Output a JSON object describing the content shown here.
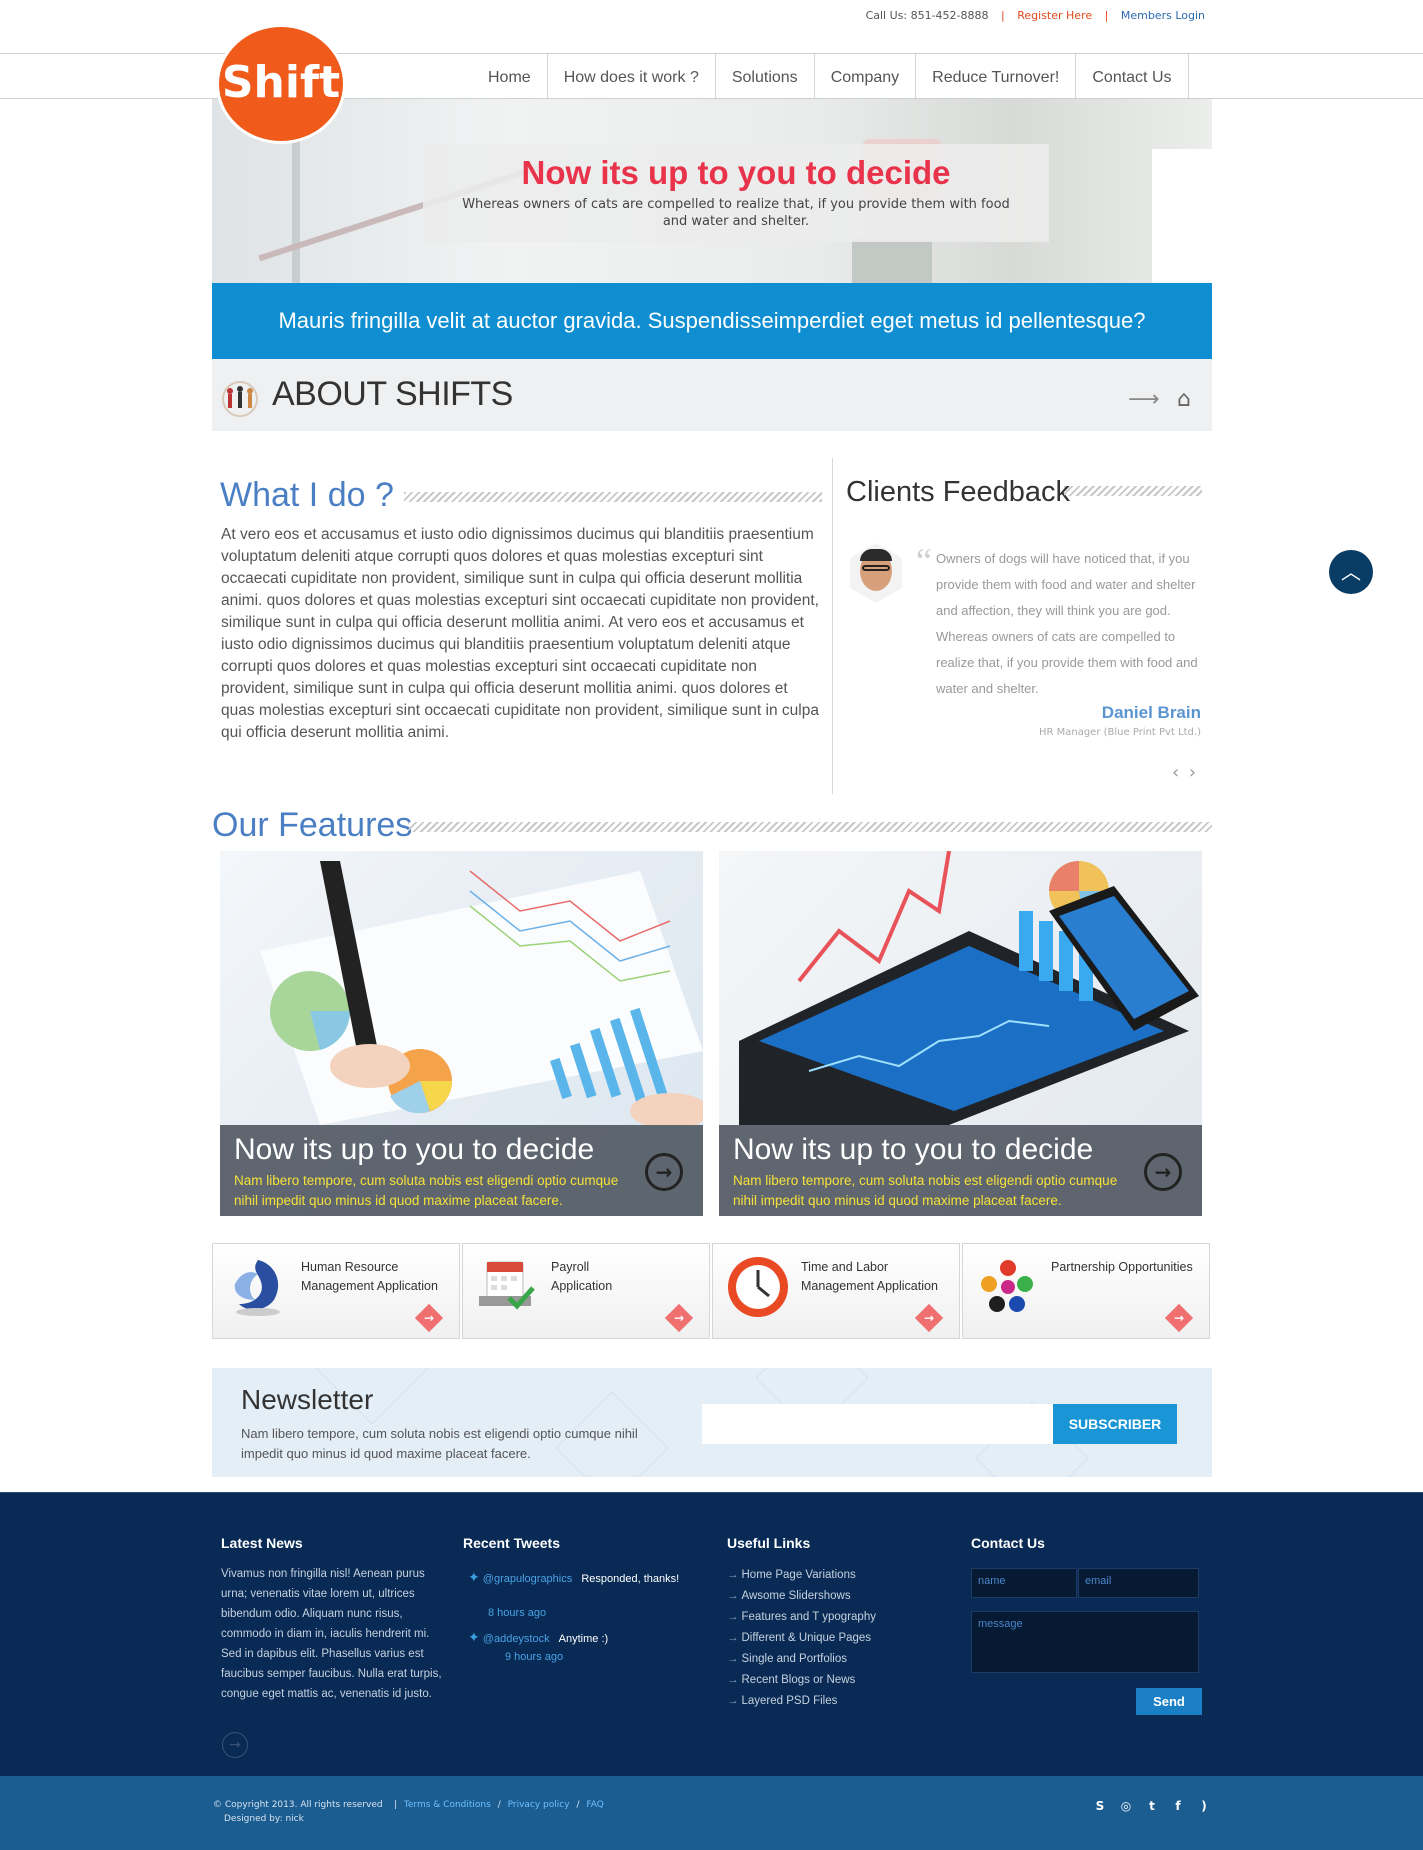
{
  "topbar": {
    "call": "Call Us: 851-452-8888",
    "sep": "|",
    "register": "Register Here",
    "members": "Members Login"
  },
  "logo": {
    "text": "Shift"
  },
  "nav": [
    "Home",
    "How does it work ?",
    "Solutions",
    "Company",
    "Reduce Turnover!",
    "Contact Us"
  ],
  "hero": {
    "title": "Now its up to you to decide",
    "text": "Whereas owners of cats are compelled to realize that, if you provide them with food and water and shelter."
  },
  "band": {
    "text": "Mauris fringilla velit at auctor gravida. Suspendisseimperdiet eget metus id pellentesque?"
  },
  "about": {
    "title": "ABOUT SHIFTS"
  },
  "what": {
    "title": "What I do ?",
    "body": "At vero eos et accusamus et iusto odio dignissimos ducimus qui blanditiis praesentium voluptatum deleniti atque corrupti quos dolores et quas molestias excepturi sint occaecati cupiditate non provident, similique sunt in culpa qui officia deserunt mollitia animi. quos dolores et quas molestias excepturi sint occaecati cupiditate non provident, similique sunt in culpa qui officia deserunt mollitia animi. At vero eos et accusamus et iusto odio dignissimos ducimus qui blanditiis praesentium voluptatum deleniti atque corrupti quos dolores et quas molestias excepturi sint occaecati cupiditate non provident, similique sunt in culpa qui officia deserunt mollitia animi. quos dolores et quas molestias excepturi sint occaecati cupiditate non provident, similique sunt in culpa qui officia deserunt mollitia animi."
  },
  "feedback": {
    "title": "Clients Feedback",
    "quote": "Owners of dogs will have noticed that, if you provide them with food and water and shelter and affection, they will think you are god. Whereas owners of cats are compelled to realize that, if you provide them with food and water and shelter.",
    "name": "Daniel Brain",
    "role": "HR Manager (Blue Print Pvt Ltd.)",
    "pager": "‹ ›"
  },
  "features": {
    "title": "Our Features",
    "cards": [
      {
        "title": "Now its up to you to decide",
        "text": "Nam libero tempore, cum soluta nobis est eligendi optio cumque nihil impedit quo minus id quod maxime placeat facere."
      },
      {
        "title": "Now its up to you to decide",
        "text": "Nam libero tempore, cum soluta nobis est eligendi optio cumque nihil impedit quo minus id quod maxime placeat facere."
      }
    ]
  },
  "apps": [
    {
      "line1": "Human Resource",
      "line2": "Management Application"
    },
    {
      "line1": "Payroll",
      "line2": "Application"
    },
    {
      "line1": "Time and Labor",
      "line2": "Management Application"
    },
    {
      "line1": "Partnership Opportunities",
      "line2": ""
    }
  ],
  "newsletter": {
    "title": "Newsletter",
    "text": "Nam libero tempore, cum soluta nobis est eligendi optio cumque nihil impedit quo minus id quod maxime placeat facere.",
    "button": "SUBSCRIBER"
  },
  "footer": {
    "news_title": "Latest News",
    "news_text": "Vivamus non fringilla nisl! Aenean purus urna; venenatis vitae lorem ut, ultrices bibendum odio. Aliquam nunc risus, commodo in diam in, iaculis hendrerit mi. Sed in dapibus elit. Phasellus varius est faucibus semper faucibus. Nulla erat turpis, congue eget mattis ac, venenatis id justo.",
    "tweets_title": "Recent Tweets",
    "tweets": [
      {
        "handle": "@grapulographics",
        "msg": "Responded, thanks!",
        "time": "8 hours ago"
      },
      {
        "handle": "@addeystock",
        "msg": "Anytime :)",
        "time": "9 hours ago"
      }
    ],
    "links_title": "Useful Links",
    "links": [
      "Home Page Variations",
      "Awsome Slidershows",
      "Features and T ypography",
      "Different & Unique Pages",
      "Single and Portfolios",
      "Recent Blogs or News",
      "Layered PSD Files"
    ],
    "contact_title": "Contact Us",
    "contact": {
      "name": "name",
      "email": "email",
      "message": "message",
      "send": "Send"
    }
  },
  "bottom": {
    "copyright": "© Copyright 2013. All rights reserved",
    "terms": "Terms & Conditions",
    "privacy": "Privacy policy",
    "faq": "FAQ",
    "slash": "/",
    "pipe": "|",
    "designed": "Designed by: nick"
  },
  "colors": {
    "accent_orange": "#f05a1a",
    "accent_blue": "#0f8ed1",
    "heading_blue": "#4b7fc4",
    "hero_red": "#e8334a",
    "footer_bg": "#082a54",
    "bottom_bg": "#1b5c91"
  },
  "icons": {
    "about": "people-circle-icon",
    "arrow": "arrow-right-icon",
    "home": "home-icon",
    "to_top": "chevron-up-icon",
    "skype": "skype-icon",
    "dribbble": "dribbble-icon",
    "twitter": "twitter-icon",
    "facebook": "facebook-icon",
    "rss": "rss-icon"
  }
}
